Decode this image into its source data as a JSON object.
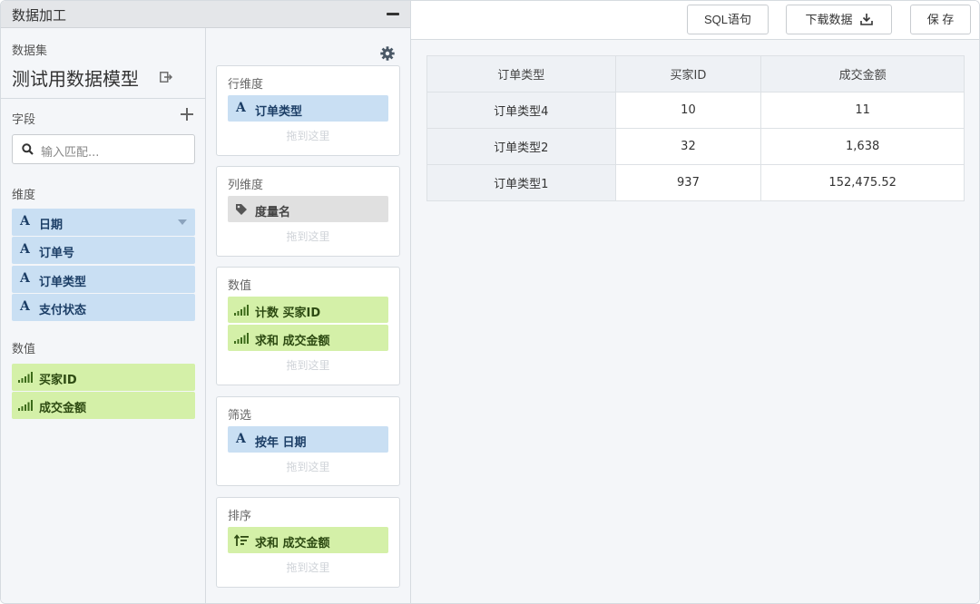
{
  "panel": {
    "title": "数据加工"
  },
  "dataset": {
    "label": "数据集",
    "name": "测试用数据模型"
  },
  "fields": {
    "title": "字段",
    "search_placeholder": "输入匹配...",
    "dimension_title": "维度",
    "dimensions": [
      "日期",
      "订单号",
      "订单类型",
      "支付状态"
    ],
    "measure_title": "数值",
    "measures": [
      "买家ID",
      "成交金额"
    ]
  },
  "shelves": {
    "drop_hint": "拖到这里",
    "rows": {
      "title": "行维度",
      "items": [
        "订单类型"
      ]
    },
    "columns": {
      "title": "列维度",
      "items": [
        "度量名"
      ]
    },
    "values": {
      "title": "数值",
      "items": [
        "计数 买家ID",
        "求和 成交金额"
      ]
    },
    "filters": {
      "title": "筛选",
      "items": [
        "按年 日期"
      ]
    },
    "sort": {
      "title": "排序",
      "items": [
        "求和 成交金额"
      ]
    }
  },
  "toolbar": {
    "sql_label": "SQL语句",
    "download_label": "下载数据",
    "save_label": "保 存"
  },
  "table": {
    "headers": [
      "订单类型",
      "买家ID",
      "成交金额"
    ],
    "rows": [
      [
        "订单类型4",
        "10",
        "11"
      ],
      [
        "订单类型2",
        "32",
        "1,638"
      ],
      [
        "订单类型1",
        "937",
        "152,475.52"
      ]
    ]
  },
  "colors": {
    "dimension": "#c9dff3",
    "measure": "#d4f0a8",
    "panel": "#f4f6f9"
  }
}
